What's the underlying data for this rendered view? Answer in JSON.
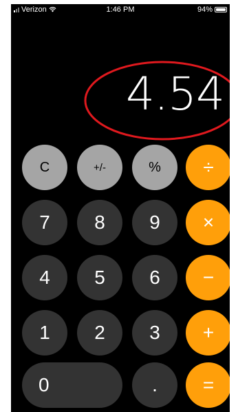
{
  "status_bar": {
    "carrier": "Verizon",
    "time": "1:46 PM",
    "battery": "94%"
  },
  "display": {
    "value": "4.54"
  },
  "keys": {
    "clear": "C",
    "plus_minus": "+/-",
    "percent": "%",
    "divide": "÷",
    "seven": "7",
    "eight": "8",
    "nine": "9",
    "multiply": "×",
    "four": "4",
    "five": "5",
    "six": "6",
    "minus": "−",
    "one": "1",
    "two": "2",
    "three": "3",
    "plus": "+",
    "zero": "0",
    "decimal": ".",
    "equals": "="
  },
  "colors": {
    "function_key": "#a5a5a5",
    "number_key": "#333333",
    "operator_key": "#ff9f0a",
    "annotation": "#e0191e"
  },
  "icons": {
    "wifi": "wifi-icon",
    "battery": "battery-icon",
    "signal": "signal-icon"
  }
}
